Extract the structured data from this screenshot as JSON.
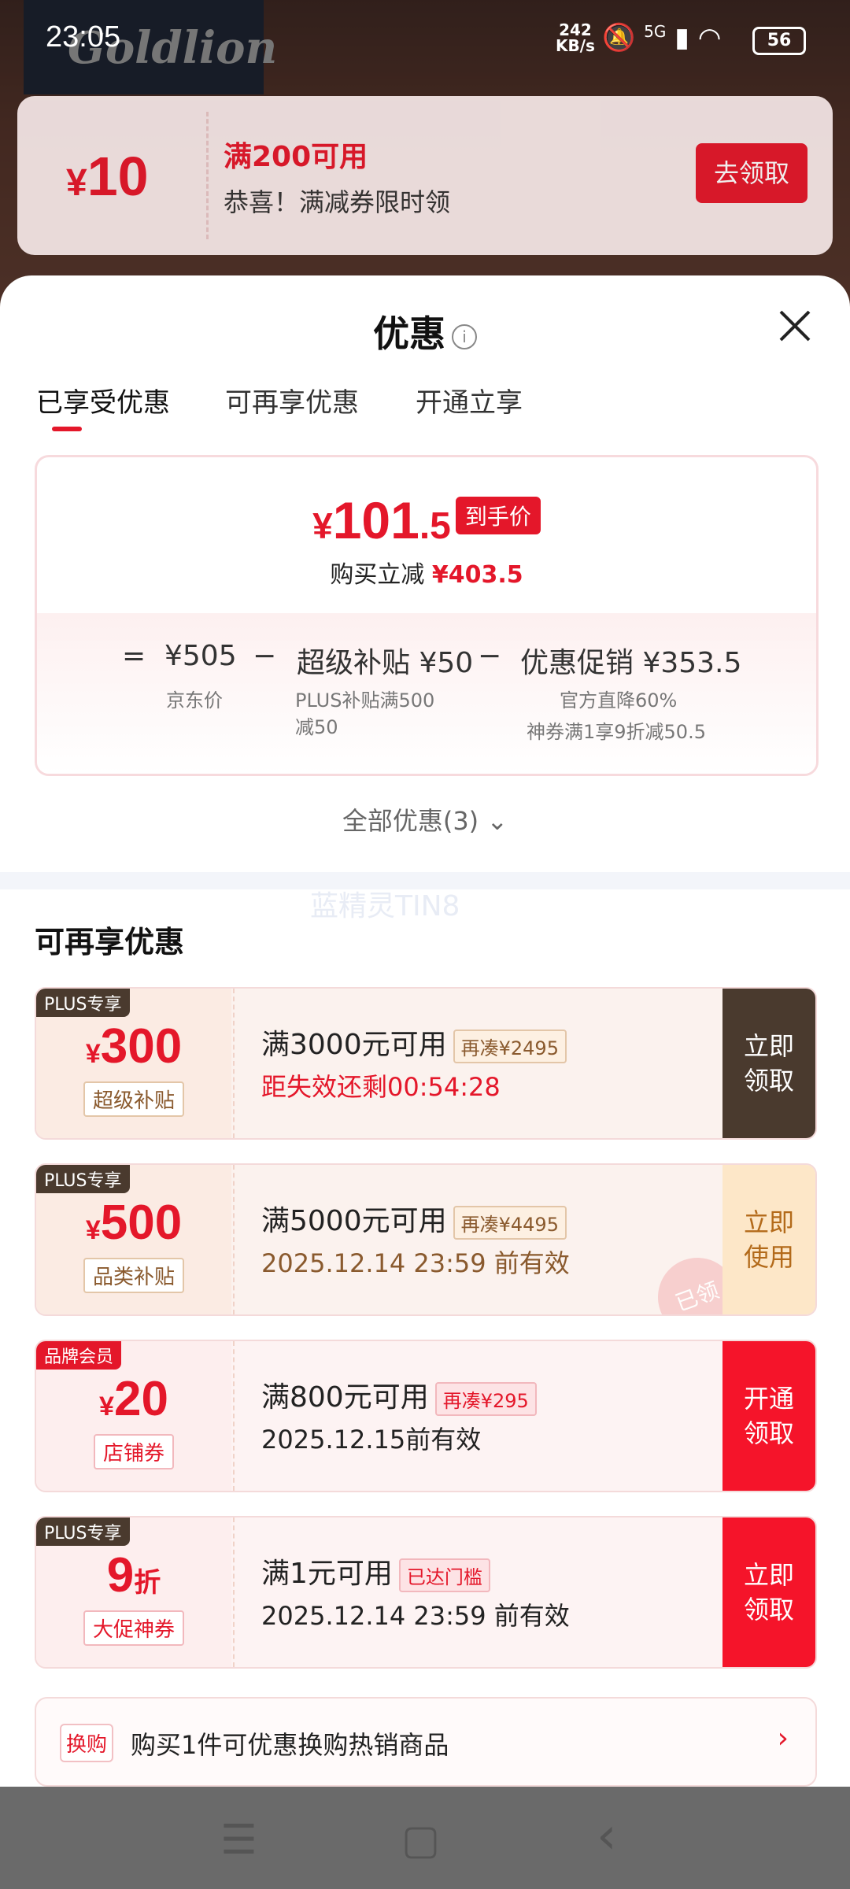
{
  "status": {
    "time": "23:05",
    "rate_top": "242",
    "rate_bottom": "KB/s",
    "network": "5G",
    "battery": "56"
  },
  "background": {
    "brand_logo": "Goldlion"
  },
  "toast": {
    "amount_symbol": "¥",
    "amount": "10",
    "condition": "满200可用",
    "desc": "恭喜！满减券限时领",
    "button": "去领取"
  },
  "sheet": {
    "title": "优惠",
    "info_icon": "i",
    "tabs": [
      {
        "label": "已享受优惠"
      },
      {
        "label": "可再享优惠"
      },
      {
        "label": "开通立享"
      }
    ],
    "price": {
      "symbol": "¥",
      "int": "101",
      "dec": ".5",
      "tag": "到手价",
      "reduce_label": "购买立减",
      "reduce_value": "¥403.5"
    },
    "formula": {
      "eq": "=",
      "jd_price": "¥505",
      "minus1": "−",
      "super_label": "超级补贴 ¥50",
      "minus2": "−",
      "promo_label": "优惠促销 ¥353.5",
      "jd_sub": "京东价",
      "plus_sub_1": "PLUS补贴满500",
      "plus_sub_2": "减50",
      "promo_sub_1": "官方直降60%",
      "promo_sub_2": "神券满1享9折减50.5"
    },
    "all_offers": "全部优惠(3)",
    "watermark": "蓝精灵TIN8",
    "section_title": "可再享优惠",
    "coupons": [
      {
        "badge": "PLUS专享",
        "symbol": "¥",
        "amount": "300",
        "unit": "",
        "kind": "超级补贴",
        "condition": "满3000元可用",
        "chip": "再凑¥2495",
        "time": "距失效还剩00:54:28",
        "action1": "立即",
        "action2": "领取"
      },
      {
        "badge": "PLUS专享",
        "symbol": "¥",
        "amount": "500",
        "unit": "",
        "kind": "品类补贴",
        "condition": "满5000元可用",
        "chip": "再凑¥4495",
        "time": "2025.12.14 23:59 前有效",
        "action1": "立即",
        "action2": "使用",
        "stamp": "已领"
      },
      {
        "badge": "品牌会员",
        "symbol": "¥",
        "amount": "20",
        "unit": "",
        "kind": "店铺券",
        "condition": "满800元可用",
        "chip": "再凑¥295",
        "time": "2025.12.15前有效",
        "action1": "开通",
        "action2": "领取"
      },
      {
        "badge": "PLUS专享",
        "symbol": "",
        "amount": "9",
        "unit": "折",
        "kind": "大促神券",
        "condition": "满1元可用",
        "chip": "已达门槛",
        "time": "2025.12.14 23:59 前有效",
        "action1": "立即",
        "action2": "领取"
      }
    ],
    "swap": {
      "tag": "换购",
      "text": "购买1件可优惠换购热销商品",
      "arrow": "›"
    }
  },
  "nav": {
    "menu": "☰",
    "home": "▢",
    "back": "‹"
  },
  "colors": {
    "accent": "#e4172a",
    "plus_brown": "#4a3a2e",
    "orange_soft": "#fde7c8"
  }
}
